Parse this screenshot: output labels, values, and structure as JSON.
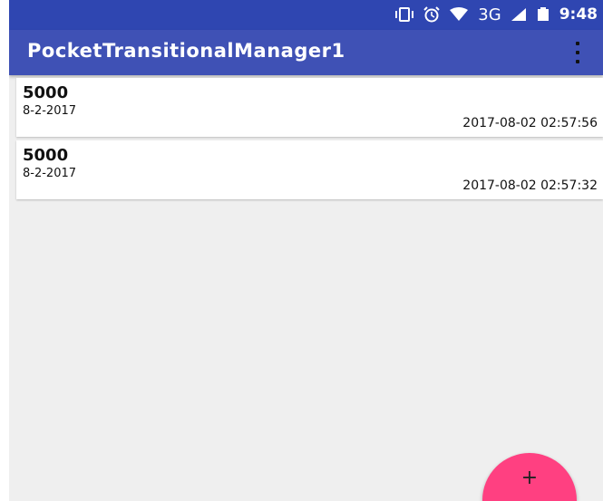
{
  "status_bar": {
    "network": "3G",
    "time": "9:48",
    "icons": [
      "vibrate-icon",
      "alarm-icon",
      "wifi-icon",
      "cell-signal-icon",
      "battery-icon"
    ]
  },
  "toolbar": {
    "title": "PocketTransitionalManager1",
    "menu_icon": "overflow-menu-icon"
  },
  "entries": [
    {
      "amount": "5000",
      "date": "8-2-2017",
      "timestamp": "2017-08-02 02:57:56"
    },
    {
      "amount": "5000",
      "date": "8-2-2017",
      "timestamp": "2017-08-02 02:57:32"
    }
  ],
  "fab": {
    "label": "+",
    "icon": "add-icon"
  },
  "colors": {
    "status_bar": "#2f46b1",
    "toolbar": "#3f51b5",
    "background": "#efefef",
    "fab": "#ff4081"
  }
}
